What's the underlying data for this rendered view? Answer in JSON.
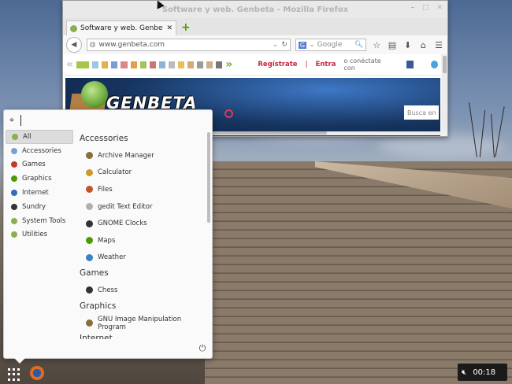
{
  "firefox": {
    "title": "Software y web. Genbeta - Mozilla Firefox",
    "tab_title": "Software y web. Genbeta",
    "url": "www.genbeta.com",
    "search_engine_badge": "G",
    "search_placeholder": "Google",
    "page": {
      "register_label": "Regístrate",
      "separator": "|",
      "login_label": "Entra",
      "connect_label": "o conéctate con",
      "logo_text": "GENBETA",
      "search_placeholder": "Busca en"
    }
  },
  "app_menu": {
    "search_value": "",
    "categories": [
      {
        "label": "All",
        "color": "#8ab04b",
        "active": true
      },
      {
        "label": "Accessories",
        "color": "#7aa3c9",
        "active": false
      },
      {
        "label": "Games",
        "color": "#c0392b",
        "active": false
      },
      {
        "label": "Graphics",
        "color": "#4e9a06",
        "active": false
      },
      {
        "label": "Internet",
        "color": "#2f6db5",
        "active": false
      },
      {
        "label": "Sundry",
        "color": "#333333",
        "active": false
      },
      {
        "label": "System Tools",
        "color": "#8ab04b",
        "active": false
      },
      {
        "label": "Utilities",
        "color": "#8ab04b",
        "active": false
      }
    ],
    "sections": [
      {
        "heading": "Accessories",
        "apps": [
          {
            "label": "Archive Manager",
            "color": "#8a6d3b"
          },
          {
            "label": "Calculator",
            "color": "#c89b2b"
          },
          {
            "label": "Files",
            "color": "#c0542b"
          },
          {
            "label": "gedit Text Editor",
            "color": "#b0b0b0"
          },
          {
            "label": "GNOME Clocks",
            "color": "#333333"
          },
          {
            "label": "Maps",
            "color": "#4e9a06"
          },
          {
            "label": "Weather",
            "color": "#3b82c4"
          }
        ]
      },
      {
        "heading": "Games",
        "apps": [
          {
            "label": "Chess",
            "color": "#333333"
          }
        ]
      },
      {
        "heading": "Graphics",
        "apps": [
          {
            "label": "GNU Image Manipulation Program",
            "color": "#8a6d3b"
          }
        ]
      },
      {
        "heading": "Internet",
        "apps": []
      }
    ]
  },
  "taskbar": {
    "time": "00:18"
  }
}
